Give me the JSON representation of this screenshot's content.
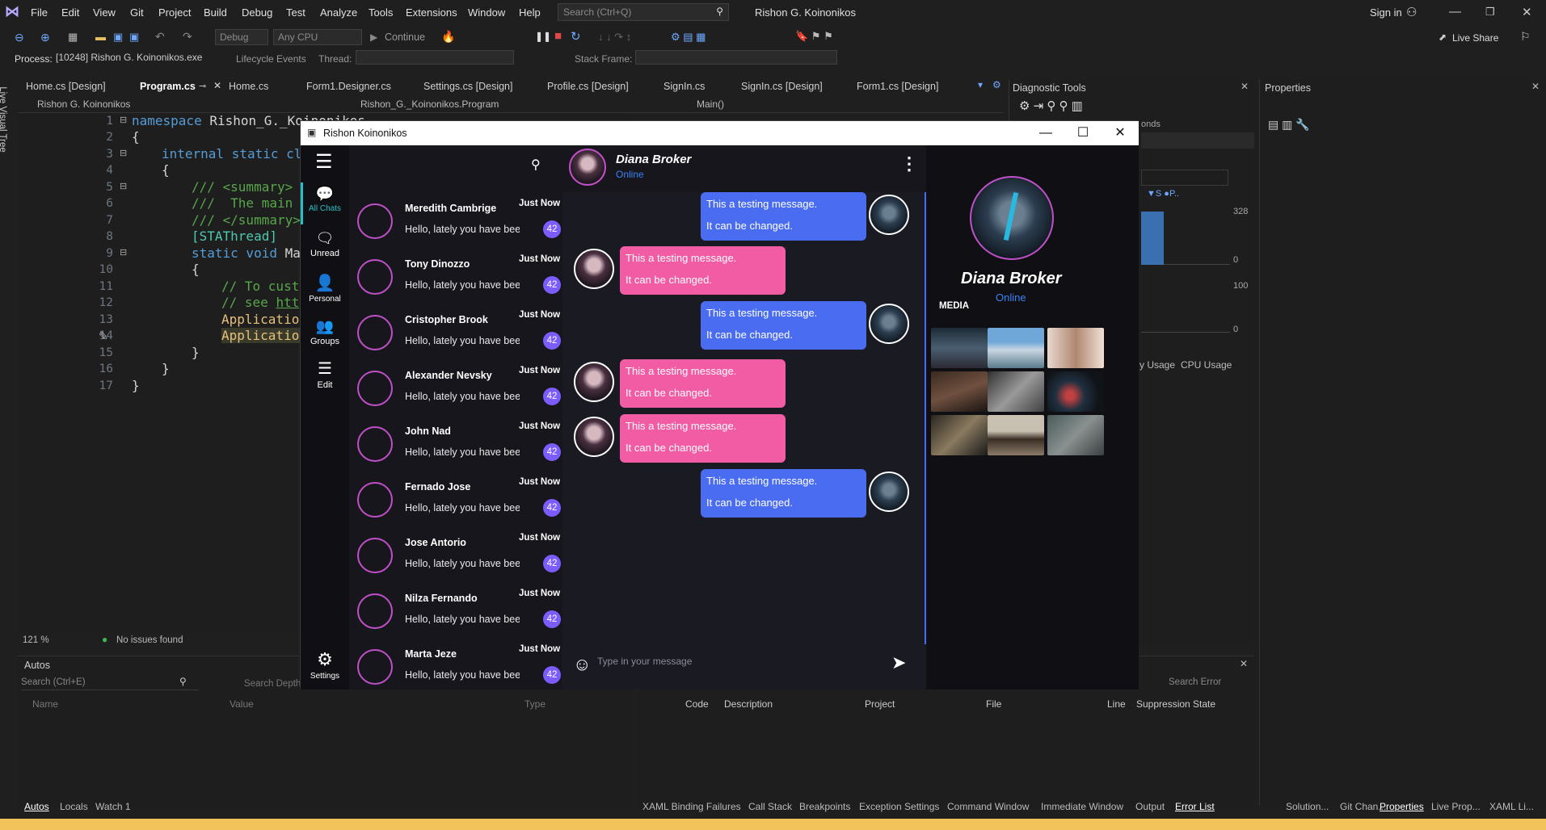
{
  "vs": {
    "menu": [
      "File",
      "Edit",
      "View",
      "Git",
      "Project",
      "Build",
      "Debug",
      "Test",
      "Analyze",
      "Tools",
      "Extensions",
      "Window",
      "Help"
    ],
    "search_placeholder": "Search (Ctrl+Q)",
    "solution_title": "Rishon G. Koinonikos",
    "sign_in": "Sign in",
    "live_share": "Live Share",
    "config": "Debug",
    "platform": "Any CPU",
    "continue": "Continue",
    "process_label": "Process:",
    "process_value": "[10248] Rishon G. Koinonikos.exe",
    "lifecycle": "Lifecycle Events",
    "thread_label": "Thread:",
    "stack_frame": "Stack Frame:",
    "side_tab": "Live Visual Tree",
    "tabs": [
      "Home.cs [Design]",
      "Program.cs",
      "Home.cs",
      "Form1.Designer.cs",
      "Settings.cs [Design]",
      "Profile.cs [Design]",
      "SignIn.cs",
      "SignIn.cs [Design]",
      "Form1.cs [Design]"
    ],
    "nav_project": "Rishon G. Koinonikos",
    "nav_class": "Rishon_G._Koinonikos.Program",
    "nav_member": "Main()",
    "line_numbers": [
      "1",
      "2",
      "3",
      "4",
      "5",
      "6",
      "7",
      "8",
      "9",
      "10",
      "11",
      "12",
      "13",
      "14",
      "15",
      "16",
      "17"
    ],
    "code": {
      "l1_kw": "namespace",
      "l1_rest": " Rishon_G._Koinonikos",
      "l2": "{",
      "l3_kw": "internal static cla",
      "l4": "{",
      "l5": "/// <summary>",
      "l6": "///  The main e",
      "l7": "/// </summary>",
      "l8": "[STAThread]",
      "l9_kw": "static void",
      "l9_rest": " Mai",
      "l10": "{",
      "l11": "// To custo",
      "l12_a": "// see ",
      "l12_b": "http",
      "l13": "Application",
      "l14": "Application",
      "l15": "}",
      "l16": "}",
      "l17": "}"
    },
    "zoom": "121 %",
    "issues": "No issues found",
    "diag_title": "Diagnostic Tools",
    "diag_seconds": "onds",
    "diag_y1": "328",
    "diag_y0a": "0",
    "diag_y2": "100",
    "diag_y0b": "0",
    "diag_legend": "S",
    "diag_legend2": "P..",
    "diag_tabs": [
      "y Usage",
      "CPU Usage"
    ],
    "props_title": "Properties",
    "autos_title": "Autos",
    "autos_search": "Search (Ctrl+E)",
    "search_depth": "Search Depth",
    "autos_cols": [
      "Name",
      "Value",
      "Type"
    ],
    "bottom_left_tabs": [
      "Autos",
      "Locals",
      "Watch 1"
    ],
    "error_cols": [
      "Code",
      "Description",
      "Project",
      "File",
      "Line",
      "Suppression State"
    ],
    "search_error": "Search Error",
    "bottom_tabs": [
      "XAML Binding Failures",
      "Call Stack",
      "Breakpoints",
      "Exception Settings",
      "Command Window",
      "Immediate Window",
      "Output",
      "Error List"
    ],
    "right_tabs": [
      "Solution...",
      "Git Chan...",
      "Properties",
      "Live Prop...",
      "XAML Li..."
    ]
  },
  "app": {
    "title": "Rishon  Koinonikos",
    "rail": [
      {
        "label": "All Chats",
        "icon": "chat-bubbles-icon"
      },
      {
        "label": "Unread",
        "icon": "chat-bubble-icon"
      },
      {
        "label": "Personal",
        "icon": "person-icon"
      },
      {
        "label": "Groups",
        "icon": "group-icon"
      },
      {
        "label": "Edit",
        "icon": "sliders-icon"
      }
    ],
    "settings_label": "Settings",
    "chats": [
      {
        "name": "Meredith Cambrige",
        "time": "Just Now",
        "msg": "Hello, lately you have been so",
        "count": "42"
      },
      {
        "name": "Tony Dinozzo",
        "time": "Just Now",
        "msg": "Hello, lately you have been so",
        "count": "42"
      },
      {
        "name": "Cristopher Brook",
        "time": "Just Now",
        "msg": "Hello, lately you have been so",
        "count": "42"
      },
      {
        "name": "Alexander Nevsky",
        "time": "Just Now",
        "msg": "Hello, lately you have been so",
        "count": "42"
      },
      {
        "name": "John Nad",
        "time": "Just Now",
        "msg": "Hello, lately you have been so",
        "count": "42"
      },
      {
        "name": "Fernado Jose",
        "time": "Just Now",
        "msg": "Hello, lately you have been so",
        "count": "42"
      },
      {
        "name": "Jose Antorio",
        "time": "Just Now",
        "msg": "Hello, lately you have been so",
        "count": "42"
      },
      {
        "name": "Nilza Fernando",
        "time": "Just Now",
        "msg": "Hello, lately you have been so",
        "count": "42"
      },
      {
        "name": "Marta Jeze",
        "time": "Just Now",
        "msg": "Hello, lately you have been so",
        "count": "42"
      }
    ],
    "contact_name": "Diana Broker",
    "contact_status": "Online",
    "messages": [
      {
        "dir": "out",
        "line1": "This a testing message.",
        "line2": "It can be changed."
      },
      {
        "dir": "in",
        "line1": "This a testing message.",
        "line2": "It can be changed."
      },
      {
        "dir": "out",
        "line1": "This a testing message.",
        "line2": "It can be changed."
      },
      {
        "dir": "in",
        "line1": "This a testing message.",
        "line2": "It can be changed."
      },
      {
        "dir": "in",
        "line1": "This a testing message.",
        "line2": "It can be changed."
      },
      {
        "dir": "out",
        "line1": "This a testing message.",
        "line2": "It can be changed."
      }
    ],
    "input_placeholder": "Type in your message",
    "profile_name": "Diana Broker",
    "profile_status": "Online",
    "media_label": "MEDIA",
    "colors": {
      "accent": "#22c0c8",
      "outgoing": "#4a6cf0",
      "incoming": "#f25ca4",
      "badge": "#7c5cff",
      "online": "#3b82f6"
    }
  }
}
